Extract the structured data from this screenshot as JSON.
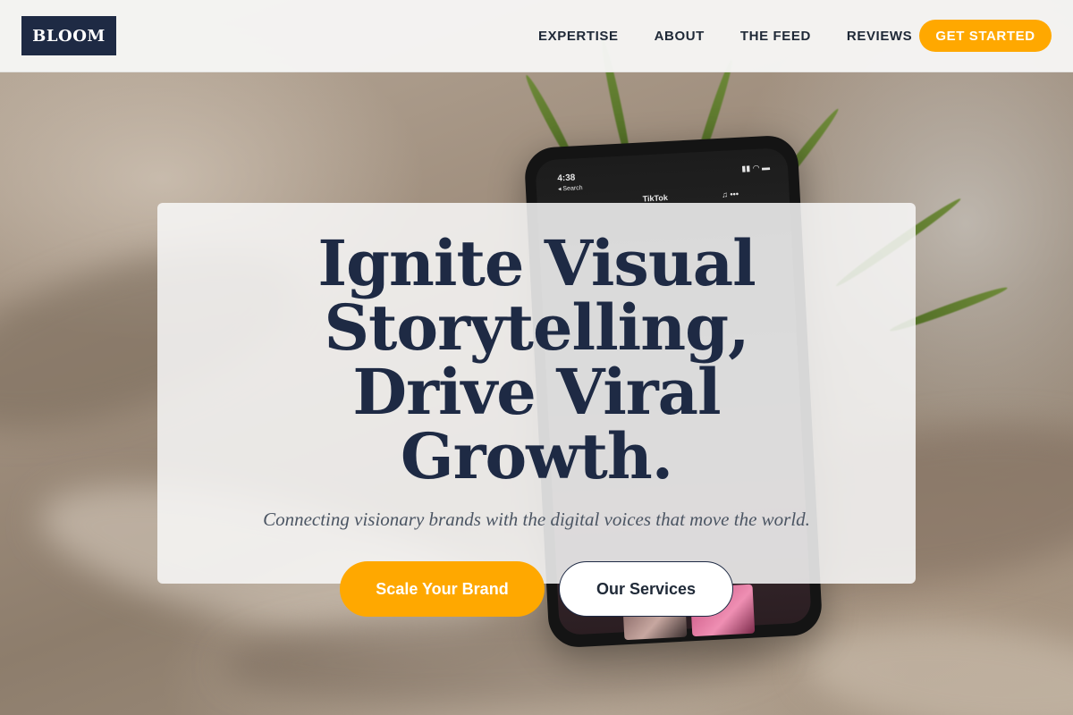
{
  "brand": {
    "logo_text": "BLOOM"
  },
  "nav": {
    "items": [
      {
        "label": "EXPERTISE"
      },
      {
        "label": "ABOUT"
      },
      {
        "label": "THE FEED"
      },
      {
        "label": "REVIEWS"
      }
    ],
    "cta_label": "GET STARTED"
  },
  "hero": {
    "headline": "Ignite Visual Storytelling, Drive Viral Growth.",
    "subheadline": "Connecting visionary brands with the digital voices that move the world.",
    "primary_button": "Scale Your Brand",
    "secondary_button": "Our Services"
  },
  "background_phone": {
    "time": "4:38",
    "back_label": "◂ Search",
    "app_title": "TikTok",
    "status_icons": "▮▮ ◠ ▬",
    "header_icons": "♫ •••"
  },
  "colors": {
    "accent": "#ffa800",
    "navy": "#1e2a44",
    "header_bg": "#f6f6f5"
  }
}
